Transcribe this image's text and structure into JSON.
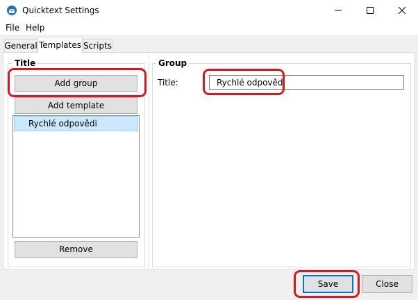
{
  "window": {
    "title": "Quicktext Settings",
    "minimize_glyph": "—",
    "maximize_glyph": "☐",
    "close_glyph": "✕"
  },
  "menu": [
    "File",
    "Help"
  ],
  "tabs": [
    {
      "label": "General",
      "active": false
    },
    {
      "label": "Templates",
      "active": true
    },
    {
      "label": "Scripts",
      "active": false
    }
  ],
  "left_panel": {
    "legend": "Title",
    "add_group_label": "Add group",
    "add_template_label": "Add template",
    "items": [
      "Rychlé odpovědi"
    ],
    "remove_label": "Remove"
  },
  "right_panel": {
    "legend": "Group",
    "title_label": "Title:",
    "title_value": "Rychlé odpovědi"
  },
  "footer": {
    "save_label": "Save",
    "close_label": "Close"
  },
  "colors": {
    "highlight": "#e0161e",
    "selection": "#cce8ff",
    "focus_border": "#0078d7"
  }
}
